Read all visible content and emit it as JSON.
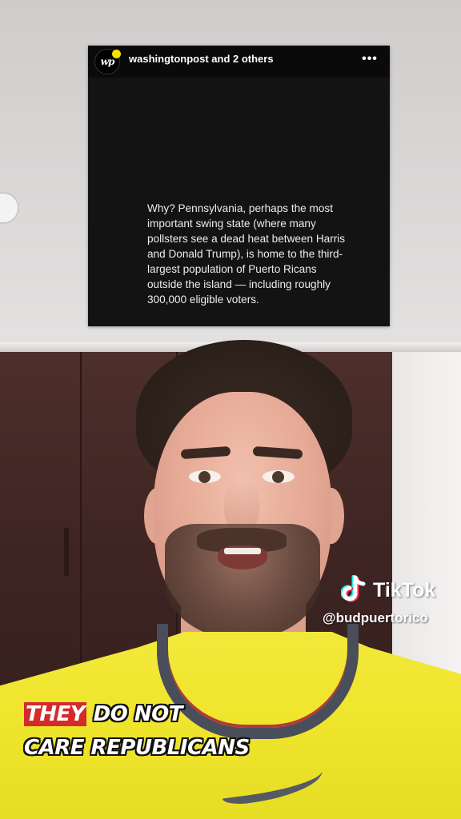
{
  "post": {
    "username": "washingtonpost",
    "others": " and 2 others",
    "avatar_monogram": "wp",
    "more_icon": "more-horizontal-icon",
    "body": "Why? Pennsylvania, perhaps the most important swing state (where many pollsters see a dead heat between Harris and Donald Trump), is home to the third-largest population of Puerto Ricans outside the island — including roughly 300,000 eligible voters."
  },
  "watermark": {
    "brand": "TikTok",
    "handle": "@budpuertorico",
    "logo_icon": "tiktok-note-icon"
  },
  "caption": {
    "highlight": "THEY",
    "line1_rest": " DO NOT",
    "line2": "CARE REPUBLICANS",
    "highlight_color": "#d42a2a"
  },
  "colors": {
    "shirt": "#f0e62e",
    "post_bg": "#131313",
    "avatar_accent": "#f5e000"
  }
}
